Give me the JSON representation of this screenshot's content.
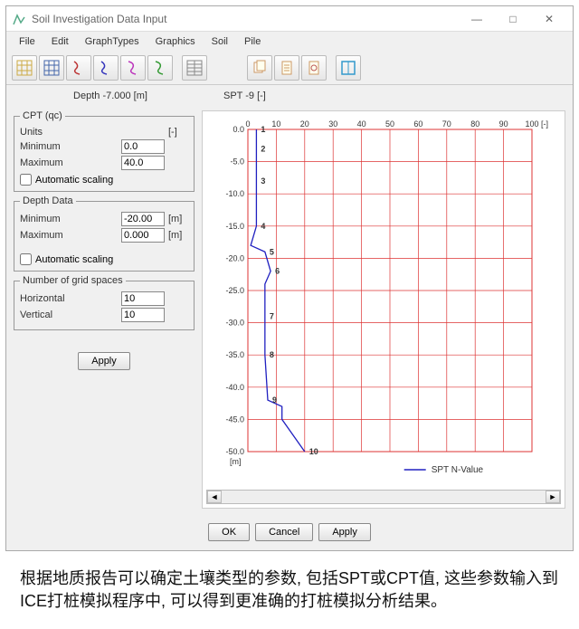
{
  "window": {
    "title": "Soil Investigation Data Input"
  },
  "menu": {
    "file": "File",
    "edit": "Edit",
    "graphtypes": "GraphTypes",
    "graphics": "Graphics",
    "soil": "Soil",
    "pile": "Pile"
  },
  "info": {
    "depth_label": "Depth -7.000 [m]",
    "spt_label": "SPT -9 [-]"
  },
  "panels": {
    "cpt": {
      "legend": "CPT (qc)",
      "units_label": "Units",
      "units_value": "[-]",
      "min_label": "Minimum",
      "min_value": "0.0",
      "max_label": "Maximum",
      "max_value": "40.0",
      "auto_label": "Automatic scaling"
    },
    "depth": {
      "legend": "Depth Data",
      "min_label": "Minimum",
      "min_value": "-20.00",
      "min_unit": "[m]",
      "max_label": "Maximum",
      "max_value": "0.000",
      "max_unit": "[m]",
      "auto_label": "Automatic scaling"
    },
    "grid_group": {
      "legend": "Number of grid spaces",
      "horiz_label": "Horizontal",
      "horiz_value": "10",
      "vert_label": "Vertical",
      "vert_value": "10"
    },
    "apply_side": "Apply"
  },
  "chart_data": {
    "type": "line",
    "xlabel": "[-]",
    "ylabel": "[m]",
    "xlim": [
      0,
      100
    ],
    "ylim": [
      -50,
      0
    ],
    "x_ticks": [
      0,
      10,
      20,
      30,
      40,
      50,
      60,
      70,
      80,
      90,
      100
    ],
    "y_ticks": [
      "0.0",
      "-5.0",
      "-10.0",
      "-15.0",
      "-20.0",
      "-25.0",
      "-30.0",
      "-35.0",
      "-40.0",
      "-45.0",
      "-50.0"
    ],
    "series": [
      {
        "name": "SPT N-Value",
        "color": "#2020c0",
        "points": [
          {
            "x": 3,
            "y": 0,
            "label": "1"
          },
          {
            "x": 3,
            "y": -3,
            "label": "2"
          },
          {
            "x": 3,
            "y": -8,
            "label": "3"
          },
          {
            "x": 3,
            "y": -15,
            "label": "4"
          },
          {
            "x": 1,
            "y": -18
          },
          {
            "x": 6,
            "y": -19,
            "label": "5"
          },
          {
            "x": 8,
            "y": -22,
            "label": "6"
          },
          {
            "x": 6,
            "y": -24
          },
          {
            "x": 6,
            "y": -29,
            "label": "7"
          },
          {
            "x": 6,
            "y": -35,
            "label": "8"
          },
          {
            "x": 7,
            "y": -42,
            "label": "9"
          },
          {
            "x": 12,
            "y": -43
          },
          {
            "x": 12,
            "y": -45
          },
          {
            "x": 20,
            "y": -50,
            "label": "10"
          }
        ]
      }
    ],
    "legend_label": "SPT N-Value"
  },
  "bottom": {
    "ok": "OK",
    "cancel": "Cancel",
    "apply": "Apply"
  },
  "caption": "根据地质报告可以确定土壤类型的参数, 包括SPT或CPT值, 这些参数输入到ICE打桩模拟程序中, 可以得到更准确的打桩模拟分析结果。"
}
